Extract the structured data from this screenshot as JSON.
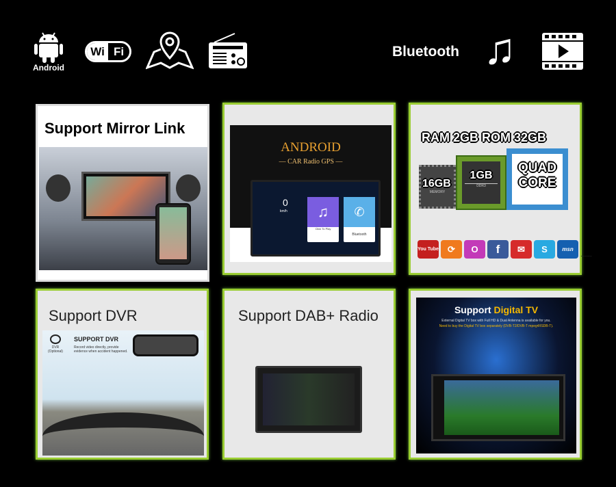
{
  "header_icons": {
    "android_label": "Android",
    "wifi_left": "Wi",
    "wifi_right": "Fi",
    "bluetooth_label": "Bluetooth"
  },
  "cards": {
    "mirror_link": {
      "title": "Support Mirror Link"
    },
    "android": {
      "title": "ANDROID",
      "subtitle": "— CAR Radio GPS —",
      "speed": "0",
      "speed_unit": "km/h",
      "music_caption": "Click To Play",
      "bt_caption": "Bluetooth"
    },
    "specs": {
      "title": "RAM 2GB ROM 32GB",
      "memory": "16GB",
      "memory_label": "MEMORY",
      "ram": "1GB",
      "ram_label": "DDR3",
      "cpu_line1": "QUAD",
      "cpu_line2": "CORE",
      "apps": [
        "You Tube",
        "",
        "",
        "f",
        "",
        "S",
        "msn"
      ],
      "more": "......"
    },
    "dvr": {
      "title": "Support  DVR",
      "heading": "SUPPORT DVR",
      "desc": "Record video directly, provide evidence when accident happened.",
      "icon_label": "DVR (Optional)"
    },
    "dab": {
      "title": "Support DAB+ Radio"
    },
    "tv": {
      "title_white": "Support ",
      "title_yellow": "Digital TV",
      "line1": "External Digital TV box with Full HD & Dual Antenna is available for you.",
      "line2": "Need to buy the Digital TV box separately (DVB-T2/DVB-T mpeg4/ISDB-T)."
    }
  },
  "colors": {
    "accent_green": "#9acd32",
    "tv_yellow": "#f5b800",
    "android_gold": "#e8a030"
  }
}
